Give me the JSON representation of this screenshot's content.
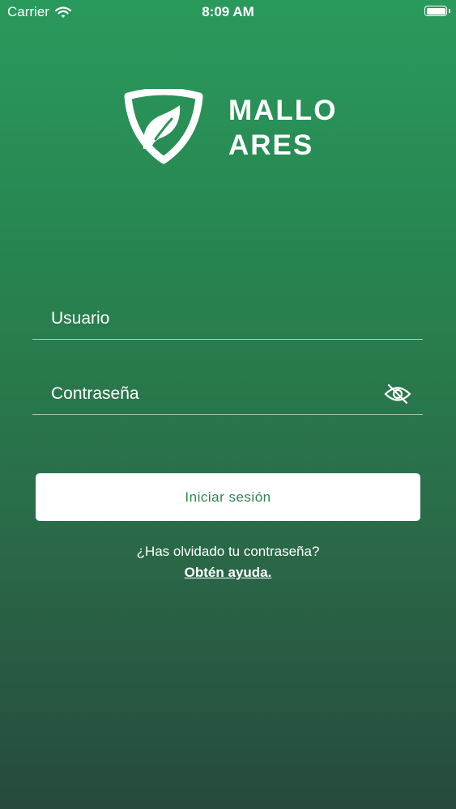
{
  "status_bar": {
    "carrier": "Carrier",
    "time": "8:09 AM"
  },
  "brand": {
    "line1": "MALLO",
    "line2": "ARES"
  },
  "login": {
    "username_placeholder": "Usuario",
    "password_placeholder": "Contraseña",
    "submit_label": "Iniciar sesión",
    "forgot_text": "¿Has olvidado tu contraseña?",
    "help_link": "Obtén ayuda."
  },
  "icons": {
    "wifi": "wifi-icon",
    "battery": "battery-icon",
    "logo": "shield-leaf-logo",
    "visibility": "eye-off-icon"
  }
}
